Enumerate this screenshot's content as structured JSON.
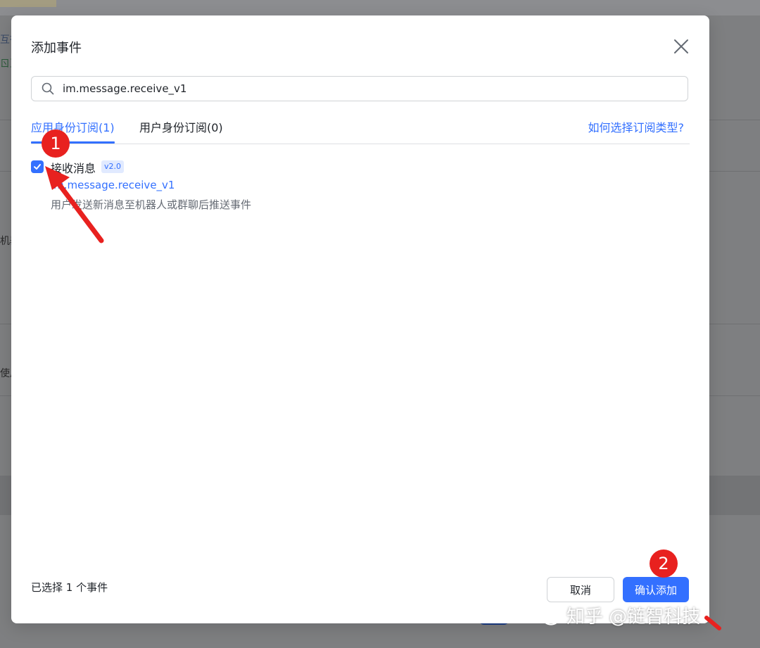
{
  "background": {
    "fragments": [
      "互行",
      "ㄖ互",
      "机器",
      "使用"
    ]
  },
  "modal": {
    "title": "添加事件",
    "close_icon": "close-icon"
  },
  "search": {
    "value": "im.message.receive_v1",
    "icon": "search-icon"
  },
  "tabs": [
    {
      "label": "应用身份订阅(1)",
      "active": true
    },
    {
      "label": "用户身份订阅(0)",
      "active": false
    }
  ],
  "help_link": "如何选择订阅类型?",
  "event": {
    "checked": true,
    "name": "接收消息",
    "version": "v2.0",
    "key": "im.message.receive_v1",
    "description": "用户发送新消息至机器人或群聊后推送事件"
  },
  "footer": {
    "selected_count": "已选择 1 个事件",
    "cancel_label": "取消",
    "confirm_label": "确认添加"
  },
  "annotations": {
    "marker_1": "1",
    "marker_2": "2",
    "color": "#e8211f"
  },
  "watermark": {
    "text": "知乎 @链智科技",
    "icon": "wechat-icon"
  },
  "colors": {
    "accent": "#3370ff",
    "overlay": "#7e7f81"
  }
}
